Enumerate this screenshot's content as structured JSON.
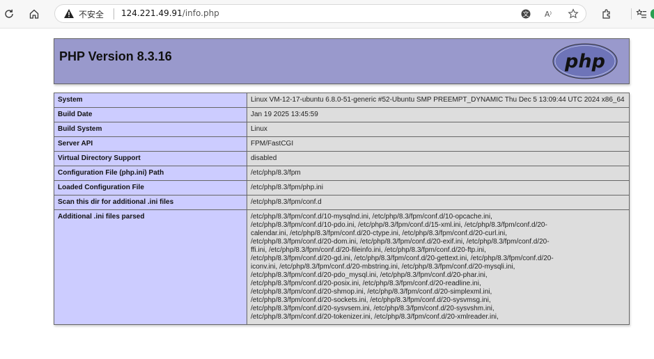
{
  "browser": {
    "security_label": "不安全",
    "url": "124.221.49.91/info.php",
    "url_host": "124.221.49.91",
    "url_path": "/info.php",
    "read_aloud_label": "A⁾"
  },
  "header": {
    "title": "PHP Version 8.3.16",
    "logo_text": "php"
  },
  "rows": [
    {
      "key": "System",
      "value": "Linux VM-12-17-ubuntu 6.8.0-51-generic #52-Ubuntu SMP PREEMPT_DYNAMIC Thu Dec 5 13:09:44 UTC 2024 x86_64"
    },
    {
      "key": "Build Date",
      "value": "Jan 19 2025 13:45:59"
    },
    {
      "key": "Build System",
      "value": "Linux"
    },
    {
      "key": "Server API",
      "value": "FPM/FastCGI"
    },
    {
      "key": "Virtual Directory Support",
      "value": "disabled"
    },
    {
      "key": "Configuration File (php.ini) Path",
      "value": "/etc/php/8.3/fpm"
    },
    {
      "key": "Loaded Configuration File",
      "value": "/etc/php/8.3/fpm/php.ini"
    },
    {
      "key": "Scan this dir for additional .ini files",
      "value": "/etc/php/8.3/fpm/conf.d"
    },
    {
      "key": "Additional .ini files parsed",
      "lines": [
        "/etc/php/8.3/fpm/conf.d/10-mysqlnd.ini, /etc/php/8.3/fpm/conf.d/10-opcache.ini,",
        "/etc/php/8.3/fpm/conf.d/10-pdo.ini, /etc/php/8.3/fpm/conf.d/15-xml.ini, /etc/php/8.3/fpm/conf.d/20-",
        "calendar.ini, /etc/php/8.3/fpm/conf.d/20-ctype.ini, /etc/php/8.3/fpm/conf.d/20-curl.ini,",
        "/etc/php/8.3/fpm/conf.d/20-dom.ini, /etc/php/8.3/fpm/conf.d/20-exif.ini, /etc/php/8.3/fpm/conf.d/20-",
        "ffi.ini, /etc/php/8.3/fpm/conf.d/20-fileinfo.ini, /etc/php/8.3/fpm/conf.d/20-ftp.ini,",
        "/etc/php/8.3/fpm/conf.d/20-gd.ini, /etc/php/8.3/fpm/conf.d/20-gettext.ini, /etc/php/8.3/fpm/conf.d/20-",
        "iconv.ini, /etc/php/8.3/fpm/conf.d/20-mbstring.ini, /etc/php/8.3/fpm/conf.d/20-mysqli.ini,",
        "/etc/php/8.3/fpm/conf.d/20-pdo_mysql.ini, /etc/php/8.3/fpm/conf.d/20-phar.ini,",
        "/etc/php/8.3/fpm/conf.d/20-posix.ini, /etc/php/8.3/fpm/conf.d/20-readline.ini,",
        "/etc/php/8.3/fpm/conf.d/20-shmop.ini, /etc/php/8.3/fpm/conf.d/20-simplexml.ini,",
        "/etc/php/8.3/fpm/conf.d/20-sockets.ini, /etc/php/8.3/fpm/conf.d/20-sysvmsg.ini,",
        "/etc/php/8.3/fpm/conf.d/20-sysvsem.ini, /etc/php/8.3/fpm/conf.d/20-sysvshm.ini,",
        "/etc/php/8.3/fpm/conf.d/20-tokenizer.ini, /etc/php/8.3/fpm/conf.d/20-xmlreader.ini,"
      ]
    }
  ],
  "colors": {
    "header_bg": "#9999cc",
    "key_bg": "#ccccff",
    "value_bg": "#dddddd",
    "logo_bg": "#6e74b8"
  }
}
